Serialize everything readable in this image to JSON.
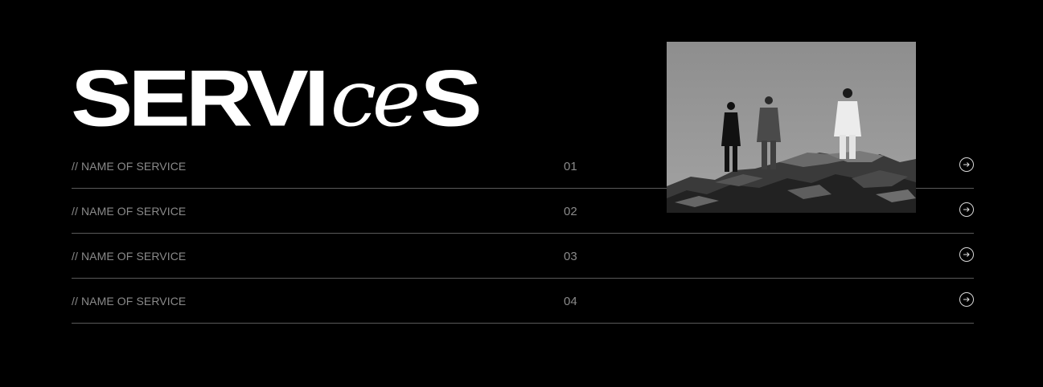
{
  "heading": {
    "part1": "SERVI",
    "part2": "ce",
    "part3": "S"
  },
  "services": [
    {
      "name": "// NAME OF SERVICE",
      "number": "01",
      "icon": "arrow-right-circle-icon"
    },
    {
      "name": "// NAME OF SERVICE",
      "number": "02",
      "icon": "arrow-right-circle-icon"
    },
    {
      "name": "// NAME OF SERVICE",
      "number": "03",
      "icon": "arrow-right-circle-icon"
    },
    {
      "name": "// NAME OF SERVICE",
      "number": "04",
      "icon": "arrow-right-circle-icon"
    }
  ],
  "colors": {
    "background": "#000000",
    "heading": "#ffffff",
    "muted_text": "#8a8a8a",
    "divider": "#5a5a5a"
  }
}
